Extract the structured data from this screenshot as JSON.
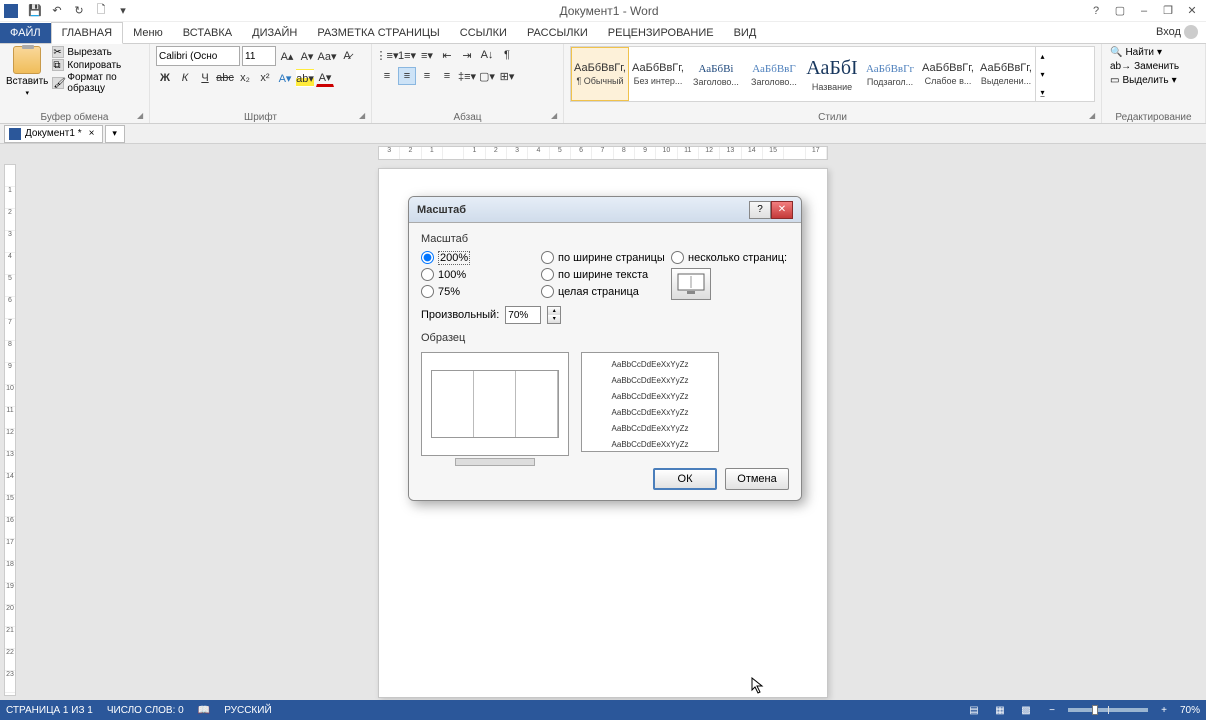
{
  "app": {
    "title": "Документ1 - Word"
  },
  "qat": {
    "save": "💾",
    "undo": "↶",
    "redo": "↻",
    "new": "🗋",
    "repeat": "⟳"
  },
  "win": {
    "help": "?",
    "ribbon_opts": "▢",
    "min": "–",
    "max": "❐",
    "close": "✕"
  },
  "tabs": {
    "file": "ФАЙЛ",
    "home": "ГЛАВНАЯ",
    "menu": "Меню",
    "insert": "ВСТАВКА",
    "design": "ДИЗАЙН",
    "layout": "РАЗМЕТКА СТРАНИЦЫ",
    "references": "ССЫЛКИ",
    "mailings": "РАССЫЛКИ",
    "review": "РЕЦЕНЗИРОВАНИЕ",
    "view": "ВИД",
    "signin": "Вход"
  },
  "ribbon": {
    "clipboard": {
      "paste": "Вставить",
      "cut": "Вырезать",
      "copy": "Копировать",
      "format_painter": "Формат по образцу",
      "label": "Буфер обмена"
    },
    "font": {
      "name": "Calibri (Осно",
      "size": "11",
      "label": "Шрифт",
      "bold": "Ж",
      "italic": "К",
      "underline": "Ч",
      "strike": "abc",
      "sub": "x₂",
      "sup": "x²"
    },
    "paragraph": {
      "label": "Абзац"
    },
    "styles": {
      "label": "Стили",
      "items": [
        {
          "preview": "АаБбВвГг,",
          "name": "¶ Обычный",
          "cls": ""
        },
        {
          "preview": "АаБбВвГг,",
          "name": "Без интер...",
          "cls": ""
        },
        {
          "preview": "АаБбВі",
          "name": "Заголово...",
          "cls": "h1"
        },
        {
          "preview": "АаБбВвГ",
          "name": "Заголово...",
          "cls": "h2"
        },
        {
          "preview": "АаБбІ",
          "name": "Название",
          "cls": "title"
        },
        {
          "preview": "АаБбВвГг",
          "name": "Подзагол...",
          "cls": "h2"
        },
        {
          "preview": "АаБбВвГг,",
          "name": "Слабое в...",
          "cls": ""
        },
        {
          "preview": "АаБбВвГг,",
          "name": "Выделени...",
          "cls": ""
        }
      ]
    },
    "editing": {
      "find": "Найти",
      "replace": "Заменить",
      "select": "Выделить",
      "label": "Редактирование"
    }
  },
  "doctab": {
    "name": "Документ1 *"
  },
  "ruler_h": [
    "3",
    "2",
    "1",
    "",
    "1",
    "2",
    "3",
    "4",
    "5",
    "6",
    "7",
    "8",
    "9",
    "10",
    "11",
    "12",
    "13",
    "14",
    "15",
    "",
    "17"
  ],
  "ruler_v": [
    "",
    "1",
    "2",
    "3",
    "4",
    "5",
    "6",
    "7",
    "8",
    "9",
    "10",
    "11",
    "12",
    "13",
    "14",
    "15",
    "16",
    "17",
    "18",
    "19",
    "20",
    "21",
    "22",
    "23"
  ],
  "dialog": {
    "title": "Масштаб",
    "section_zoom": "Масштаб",
    "r200": "200%",
    "r100": "100%",
    "r75": "75%",
    "page_width": "по ширине страницы",
    "text_width": "по ширине текста",
    "whole_page": "целая страница",
    "many_pages": "несколько страниц:",
    "custom_label": "Произвольный:",
    "custom_value": "70%",
    "section_sample": "Образец",
    "sample_line": "AaBbCcDdEeXxYyZz",
    "ok": "ОК",
    "cancel": "Отмена"
  },
  "status": {
    "page": "СТРАНИЦА 1 ИЗ 1",
    "words": "ЧИСЛО СЛОВ: 0",
    "lang": "РУССКИЙ",
    "zoom": "70%"
  }
}
